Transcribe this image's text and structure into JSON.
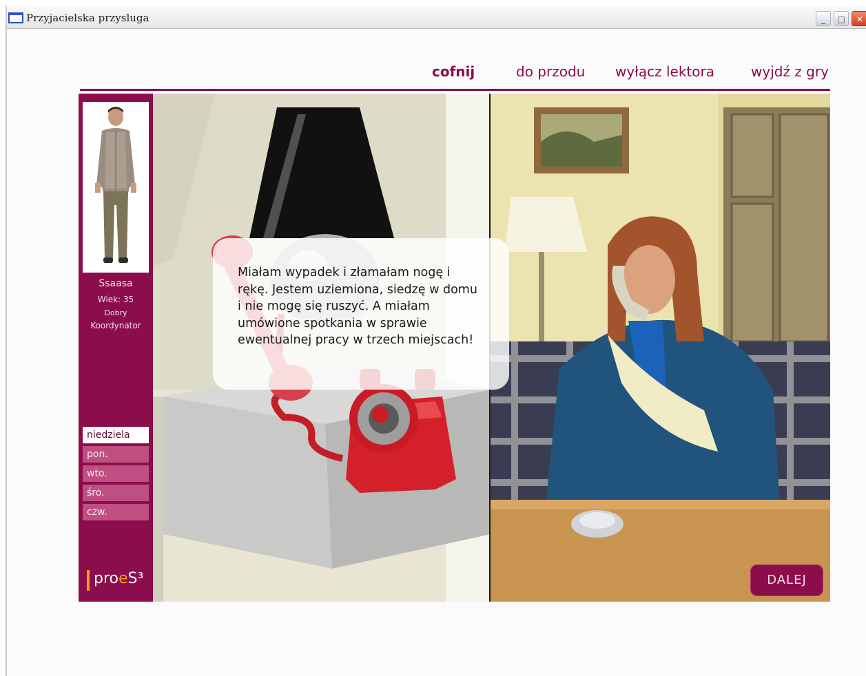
{
  "window": {
    "title": "Przyjacielska przysluga",
    "buttons": {
      "minimize": "_",
      "maximize": "□",
      "close": "✕"
    }
  },
  "nav": {
    "back": "cofnij",
    "forward": "do przodu",
    "mute_narrator": "wyłącz lektora",
    "quit": "wyjdź z gry"
  },
  "profile": {
    "name": "Ssaasa",
    "age": "Wiek: 35",
    "status": "Dobry",
    "role": "Koordynator"
  },
  "days": [
    {
      "label": "niedziela",
      "active": true
    },
    {
      "label": "pon.",
      "active": false
    },
    {
      "label": "wto.",
      "active": false
    },
    {
      "label": "śro.",
      "active": false
    },
    {
      "label": "czw.",
      "active": false
    }
  ],
  "logo": {
    "prefix": "pro",
    "e": "e",
    "suffix": "S³"
  },
  "dialog": {
    "text": "Miałam wypadek i złamałam nogę i rękę. Jestem uziemiona, siedzę w domu i nie mogę się ruszyć. A miałam umówione spotkania w sprawie ewentualnej pracy w trzech miejscach!"
  },
  "next_button": "DALEJ",
  "colors": {
    "brand": "#8c0d4b",
    "day_inactive": "#c04f81",
    "logo_accent": "#f49a1c"
  }
}
